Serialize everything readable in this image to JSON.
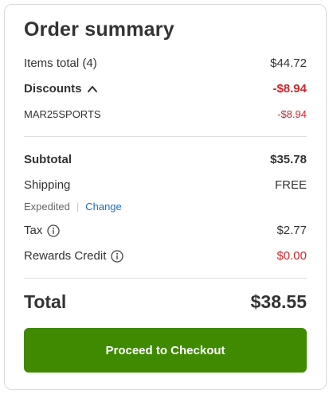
{
  "summary": {
    "title": "Order summary",
    "items_total_label": "Items total (4)",
    "items_total_value": "$44.72",
    "discounts_label": "Discounts",
    "discounts_value": "-$8.94",
    "promo_code": "MAR25SPORTS",
    "promo_value": "-$8.94",
    "subtotal_label": "Subtotal",
    "subtotal_value": "$35.78",
    "shipping_label": "Shipping",
    "shipping_value": "FREE",
    "shipping_method": "Expedited",
    "shipping_separator": "|",
    "change_label": "Change",
    "tax_label": "Tax",
    "tax_value": "$2.77",
    "rewards_label": "Rewards Credit",
    "rewards_value": "$0.00",
    "total_label": "Total",
    "total_value": "$38.55",
    "checkout_label": "Proceed to Checkout"
  },
  "icons": {
    "discounts_toggle": "chevron-up-icon",
    "tax_info": "info-icon",
    "rewards_info": "info-icon"
  },
  "colors": {
    "accent_green": "#3f8a00",
    "discount_red": "#c8282d",
    "link_blue": "#1a6fb5"
  }
}
